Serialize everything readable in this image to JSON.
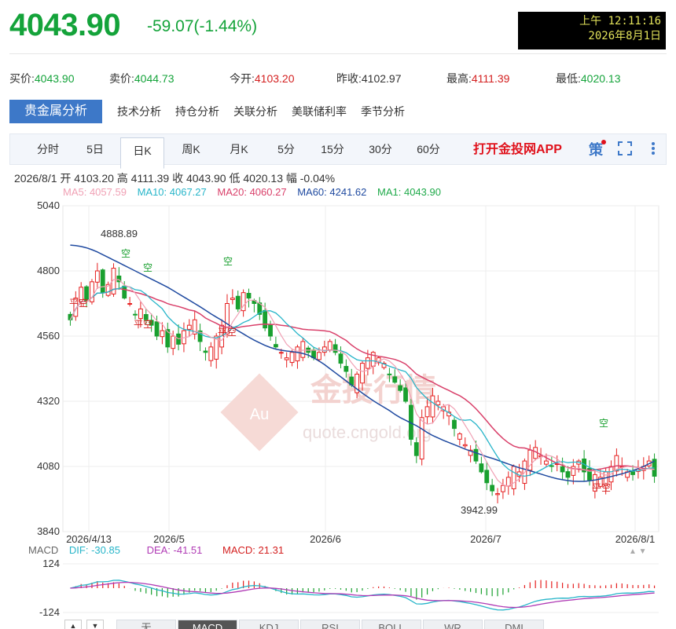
{
  "header": {
    "price": "4043.90",
    "change": "-59.07(-1.44%)",
    "clock_line1": "上午 12:11:16",
    "clock_line2": "2026年8月1日"
  },
  "quotes": [
    {
      "label": "买价:",
      "value": "4043.90",
      "color": "green"
    },
    {
      "label": "卖价:",
      "value": "4044.73",
      "color": "green"
    },
    {
      "label": "今开:",
      "value": "4103.20",
      "color": "red"
    },
    {
      "label": "昨收:",
      "value": "4102.97",
      "color": "neutral"
    },
    {
      "label": "最高:",
      "value": "4111.39",
      "color": "red"
    },
    {
      "label": "最低:",
      "value": "4020.13",
      "color": "green"
    }
  ],
  "main_tabs": [
    "贵金属分析",
    "技术分析",
    "持仓分析",
    "关联分析",
    "美联储利率",
    "季节分析"
  ],
  "periods": [
    "分时",
    "5日",
    "日K",
    "周K",
    "月K",
    "5分",
    "15分",
    "30分",
    "60分"
  ],
  "active_period": "日K",
  "app_link": "打开金投网APP",
  "policy_icon": "策",
  "ohlc": {
    "date": "2026/8/1",
    "open_label": "开",
    "open": "4103.20",
    "high_label": "高",
    "high": "4111.39",
    "close_label": "收",
    "close": "4043.90",
    "low_label": "低",
    "low": "4020.13",
    "amp_label": "幅",
    "amp": "-0.04%"
  },
  "ma": [
    {
      "label": "MA5: 4057.59",
      "color": "#f0a0b4"
    },
    {
      "label": "MA10: 4067.27",
      "color": "#27b5c9"
    },
    {
      "label": "MA20: 4060.27",
      "color": "#d9406a"
    },
    {
      "label": "MA60: 4241.62",
      "color": "#1f4aa0"
    },
    {
      "label": "MA1: 4043.90",
      "color": "#1faa4a"
    }
  ],
  "chart_data": {
    "type": "candlestick",
    "yticks": [
      "5040",
      "4800",
      "4560",
      "4320",
      "4080",
      "3840"
    ],
    "ylim": [
      3840,
      5040
    ],
    "xticks": [
      "2026/4/13",
      "2026/5",
      "2026/6",
      "2026/7",
      "2026/8/1"
    ],
    "annotations": {
      "max_label": "4888.89",
      "min_label": "3942.99"
    },
    "signal_labels": [
      "空",
      "空",
      "空",
      "空",
      "平空",
      "平空",
      "平空",
      "平空"
    ],
    "closes": [
      4620,
      4700,
      4740,
      4690,
      4760,
      4800,
      4720,
      4750,
      4810,
      4760,
      4700,
      4680,
      4640,
      4660,
      4620,
      4600,
      4560,
      4580,
      4520,
      4560,
      4530,
      4580,
      4600,
      4620,
      4540,
      4500,
      4520,
      4560,
      4600,
      4680,
      4700,
      4660,
      4720,
      4700,
      4680,
      4640,
      4590,
      4560,
      4520,
      4500,
      4480,
      4500,
      4520,
      4540,
      4500,
      4480,
      4500,
      4520,
      4540,
      4500,
      4460,
      4430,
      4380,
      4420,
      4460,
      4480,
      4500,
      4480,
      4460,
      4420,
      4390,
      4360,
      4320,
      4180,
      4120,
      4260,
      4300,
      4340,
      4320,
      4300,
      4280,
      4220,
      4200,
      4160,
      4140,
      4100,
      4060,
      4020,
      3990,
      3980,
      4010,
      4040,
      4080,
      4060,
      4100,
      4140,
      4150,
      4120,
      4100,
      4080,
      4090,
      4060,
      4040,
      4080,
      4100,
      4060,
      4030,
      4050,
      4040,
      4060,
      4080,
      4120,
      4080,
      4060,
      4050,
      4070,
      4080,
      4100,
      4043.9
    ],
    "ma60": [
      4895,
      4893,
      4890,
      4885,
      4878,
      4870,
      4860,
      4850,
      4840,
      4830,
      4820,
      4810,
      4800,
      4790,
      4780,
      4770,
      4760,
      4750,
      4740,
      4728,
      4716,
      4704,
      4692,
      4680,
      4668,
      4655,
      4642,
      4630,
      4618,
      4605,
      4592,
      4580,
      4568,
      4556,
      4545,
      4535,
      4526,
      4518,
      4512,
      4508,
      4505,
      4503,
      4500,
      4496,
      4490,
      4480,
      4468,
      4455,
      4440,
      4425,
      4410,
      4395,
      4380,
      4365,
      4350,
      4336,
      4322,
      4310,
      4298,
      4286,
      4272,
      4260,
      4250,
      4240,
      4230,
      4218,
      4205,
      4194,
      4185,
      4176,
      4168,
      4160,
      4152,
      4144,
      4137,
      4130,
      4123,
      4116,
      4110,
      4103,
      4096,
      4089,
      4082,
      4075,
      4070,
      4064,
      4058,
      4052,
      4046,
      4040,
      4035,
      4031,
      4028,
      4026,
      4025,
      4025,
      4027,
      4030,
      4034,
      4038,
      4043,
      4048,
      4053,
      4059,
      4065,
      4072,
      4080,
      4090,
      4100
    ],
    "macd_ylim": [
      -124,
      124
    ],
    "macd_yticks": [
      "124",
      "-124"
    ],
    "macd_xticks": [],
    "macd_label": "MACD",
    "dif": "DIF: -30.85",
    "dea": "DEA: -41.51",
    "macd": "MACD: 21.31"
  },
  "bottom_tabs": [
    "无",
    "MACD",
    "KDJ",
    "RSI",
    "BOLL",
    "WR",
    "DMI"
  ],
  "watermark": {
    "brand": "金投行情",
    "url": "quote.cngold.org",
    "badge": "Au"
  }
}
